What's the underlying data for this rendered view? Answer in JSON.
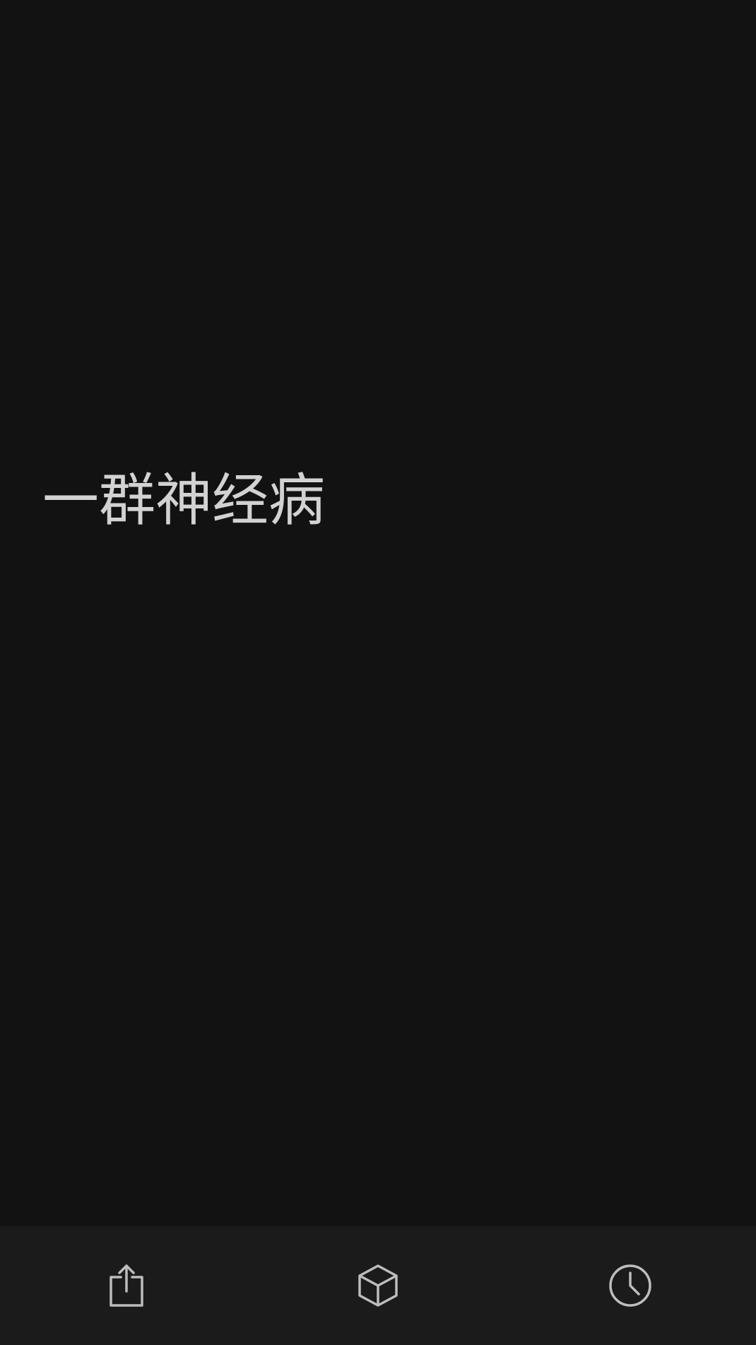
{
  "note": {
    "text": "一群神经病"
  },
  "toolbar": {
    "buttons": [
      {
        "icon": "share-icon"
      },
      {
        "icon": "cube-icon"
      },
      {
        "icon": "clock-icon"
      }
    ]
  },
  "colors": {
    "background": "#121212",
    "toolbar_background": "#1b1b1b",
    "text": "#d2d2d2",
    "icon": "#bdbdbd"
  }
}
